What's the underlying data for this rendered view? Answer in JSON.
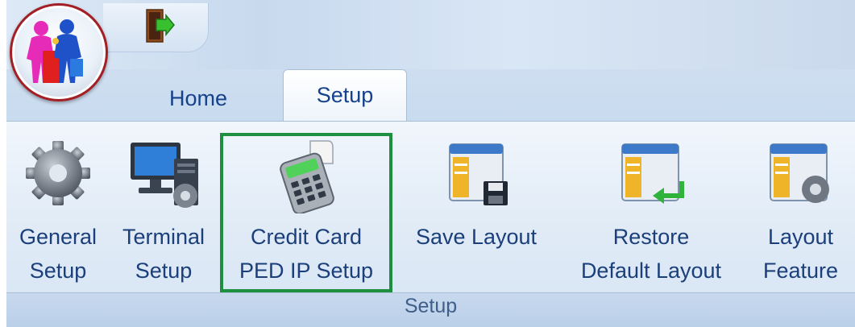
{
  "tabs": [
    {
      "label": "Home",
      "active": false
    },
    {
      "label": "Setup",
      "active": true
    }
  ],
  "quick_access": {
    "icon": "exit-door-icon"
  },
  "ribbon": {
    "group_label": "Setup",
    "buttons": [
      {
        "line1": "General",
        "line2": "Setup",
        "icon": "gear-icon"
      },
      {
        "line1": "Terminal",
        "line2": "Setup",
        "icon": "terminal-computer-icon"
      },
      {
        "line1": "Credit Card",
        "line2": "PED IP Setup",
        "icon": "card-terminal-icon",
        "highlighted": true
      },
      {
        "line1": "Save Layout",
        "line2": "",
        "icon": "save-layout-icon"
      },
      {
        "line1": "Restore",
        "line2": "Default Layout",
        "icon": "restore-layout-icon"
      },
      {
        "line1": "Layout",
        "line2": "Feature",
        "icon": "layout-feature-icon"
      }
    ]
  },
  "colors": {
    "highlight_border": "#1e8f3e",
    "tab_text": "#15428b",
    "label_text": "#1b3f7a"
  }
}
